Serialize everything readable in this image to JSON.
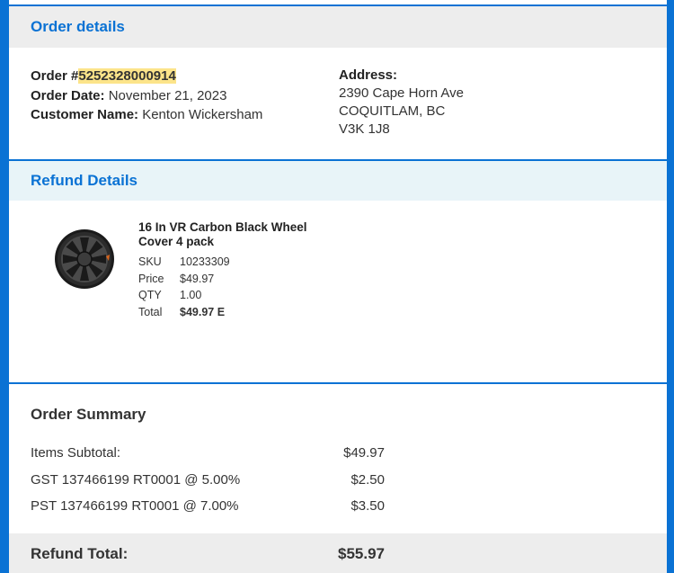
{
  "order_details": {
    "header": "Order details",
    "order_number_label": "Order #",
    "order_number": "5252328000914",
    "order_date_label": "Order Date:",
    "order_date": "November 21, 2023",
    "customer_label": "Customer Name:",
    "customer_name": "Kenton Wickersham",
    "address_label": "Address:",
    "address_lines": [
      "2390 Cape Horn Ave",
      "COQUITLAM, BC",
      "V3K 1J8"
    ]
  },
  "refund_details": {
    "header": "Refund Details",
    "item": {
      "image_icon": "wheel-cover-image",
      "name": "16 In VR Carbon Black Wheel Cover 4 pack",
      "sku_label": "SKU",
      "sku": "10233309",
      "price_label": "Price",
      "price": "$49.97",
      "qty_label": "QTY",
      "qty": "1.00",
      "total_label": "Total",
      "total": "$49.97 E"
    }
  },
  "order_summary": {
    "title": "Order Summary",
    "rows": [
      {
        "label": "Items Subtotal:",
        "value": "$49.97"
      },
      {
        "label": "GST 137466199 RT0001 @ 5.00%",
        "value": "$2.50"
      },
      {
        "label": "PST 137466199 RT0001 @ 7.00%",
        "value": "$3.50"
      }
    ],
    "refund_total_label": "Refund Total:",
    "refund_total": "$55.97"
  },
  "colors": {
    "accent": "#0a72d4",
    "highlight": "#fce48a",
    "header_bg": "#ededed",
    "refund_header_bg": "#e8f4f8"
  }
}
